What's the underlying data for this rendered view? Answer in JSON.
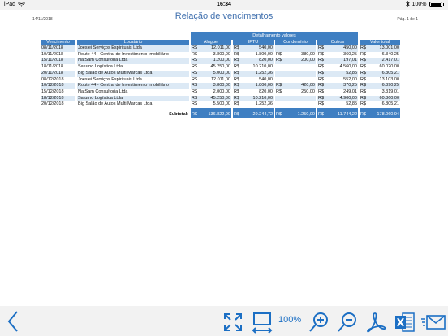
{
  "status": {
    "carrier": "iPad",
    "time": "16:34",
    "battery": "100%"
  },
  "doc": {
    "date": "14/11/2018",
    "title": "Relação de vencimentos",
    "page": "Pág. 1 de 1"
  },
  "table": {
    "group_header": "Detalhamento valores",
    "headers": {
      "vencimento": "Vencimento",
      "locatario": "Locatário",
      "aluguel": "Aluguel",
      "iptu": "IPTU",
      "condominio": "Condomínio",
      "outros": "Outros",
      "total": "Valor total"
    },
    "currency": "R$",
    "rows": [
      {
        "venc": "08/11/2018",
        "loc": "Joeslei Serviços Espirituais Ltda",
        "aluguel": "12.011,00",
        "iptu": "540,00",
        "cond": "",
        "outros": "450,00",
        "total": "13.001,00"
      },
      {
        "venc": "10/11/2018",
        "loc": "Route 44 - Central de Investimento Imobiliário",
        "aluguel": "3.800,00",
        "iptu": "1.800,00",
        "cond": "380,00",
        "outros": "360,25",
        "total": "6.340,25"
      },
      {
        "venc": "15/11/2018",
        "loc": "NatSam Consultoria Ltda",
        "aluguel": "1.200,00",
        "iptu": "820,00",
        "cond": "200,00",
        "outros": "197,01",
        "total": "2.417,01"
      },
      {
        "venc": "18/11/2018",
        "loc": "Saturno Logística Ltda",
        "aluguel": "45.250,00",
        "iptu": "10.210,00",
        "cond": "",
        "outros": "4.560,00",
        "total": "60.020,00"
      },
      {
        "venc": "20/11/2018",
        "loc": "Big Salão de Autos Multi Marcas Ltda",
        "aluguel": "5.000,00",
        "iptu": "1.252,36",
        "cond": "",
        "outros": "52,85",
        "total": "6.305,21"
      },
      {
        "venc": "08/12/2018",
        "loc": "Joeslei Serviços Espirituais Ltda",
        "aluguel": "12.011,00",
        "iptu": "540,00",
        "cond": "",
        "outros": "552,00",
        "total": "13.103,00"
      },
      {
        "venc": "10/12/2018",
        "loc": "Route 44 - Central de Investimento Imobiliário",
        "aluguel": "3.800,00",
        "iptu": "1.800,00",
        "cond": "420,00",
        "outros": "370,25",
        "total": "6.390,25"
      },
      {
        "venc": "15/12/2018",
        "loc": "NatSam Consultoria Ltda",
        "aluguel": "2.000,00",
        "iptu": "820,00",
        "cond": "250,00",
        "outros": "249,01",
        "total": "3.319,01"
      },
      {
        "venc": "18/12/2018",
        "loc": "Saturno Logística Ltda",
        "aluguel": "45.250,00",
        "iptu": "10.210,00",
        "cond": "",
        "outros": "4.900,00",
        "total": "60.360,00"
      },
      {
        "venc": "20/12/2018",
        "loc": "Big Salão de Autos Multi Marcas Ltda",
        "aluguel": "5.500,00",
        "iptu": "1.252,36",
        "cond": "",
        "outros": "52,85",
        "total": "6.805,21"
      }
    ],
    "subtotal": {
      "label": "Subtotal:",
      "aluguel": "136.822,00",
      "iptu": "29.244,72",
      "cond": "1.250,00",
      "outros": "11.744,22",
      "total": "178.060,94"
    }
  },
  "toolbar": {
    "zoom": "100%",
    "icons": [
      "back-icon",
      "fullscreen-icon",
      "fit-width-icon",
      "zoom-in-icon",
      "zoom-out-icon",
      "pdf-icon",
      "excel-icon",
      "email-icon"
    ]
  },
  "colors": {
    "accent": "#3f7fc2",
    "row_alt": "#dce9f5",
    "icon": "#1c6fc4",
    "title": "#3f6fae"
  }
}
